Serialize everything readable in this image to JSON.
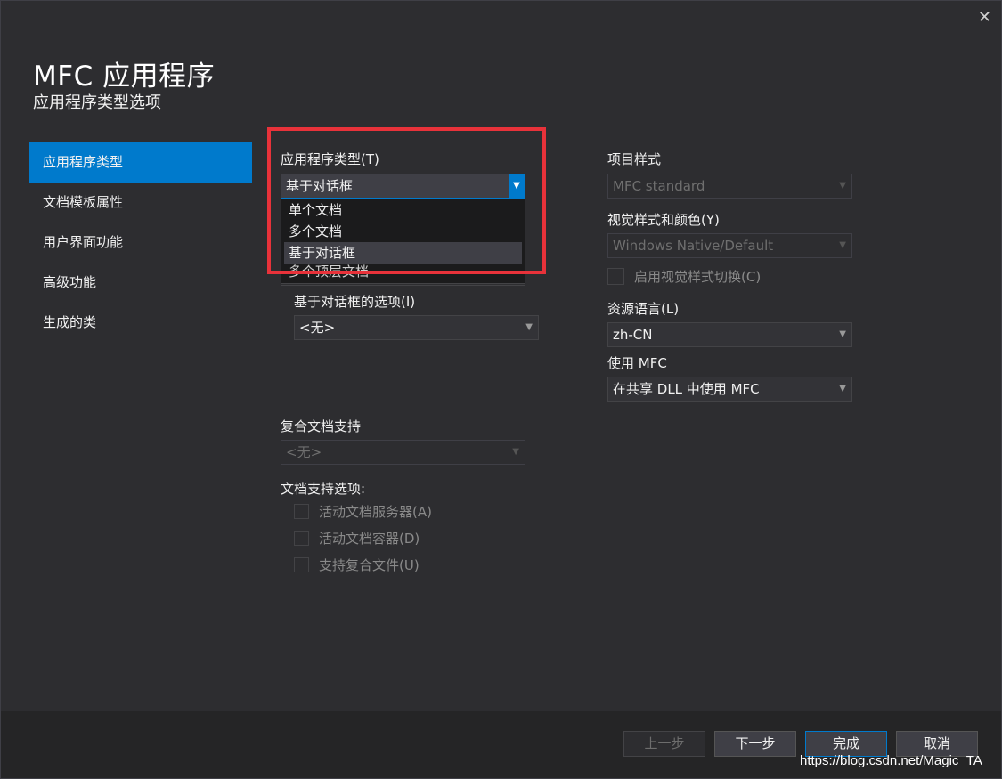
{
  "window": {
    "close_glyph": "✕"
  },
  "header": {
    "title": "MFC 应用程序",
    "subtitle": "应用程序类型选项"
  },
  "sidebar": {
    "items": [
      {
        "label": "应用程序类型",
        "active": true
      },
      {
        "label": "文档模板属性"
      },
      {
        "label": "用户界面功能"
      },
      {
        "label": "高级功能"
      },
      {
        "label": "生成的类"
      }
    ]
  },
  "app_type": {
    "label": "应用程序类型(T)",
    "value": "基于对话框",
    "options": [
      "单个文档",
      "多个文档",
      "基于对话框",
      "多个顶层文档"
    ],
    "selected_index": 2
  },
  "dialog_options": {
    "label": "基于对话框的选项(I)",
    "value": "<无>"
  },
  "compound": {
    "label": "复合文档支持",
    "value": "<无>"
  },
  "doc_support": {
    "label": "文档支持选项:",
    "options": [
      "活动文档服务器(A)",
      "活动文档容器(D)",
      "支持复合文件(U)"
    ]
  },
  "project_style": {
    "label": "项目样式",
    "value": "MFC standard"
  },
  "visual_style": {
    "label": "视觉样式和颜色(Y)",
    "value": "Windows Native/Default",
    "toggle_label": "启用视觉样式切换(C)"
  },
  "resource_lang": {
    "label": "资源语言(L)",
    "value": "zh-CN"
  },
  "use_mfc": {
    "label": "使用 MFC",
    "value": "在共享 DLL 中使用 MFC"
  },
  "buttons": {
    "back": "上一步",
    "next": "下一步",
    "finish": "完成",
    "cancel": "取消"
  },
  "watermark": "https://blog.csdn.net/Magic_TA",
  "colors": {
    "accent": "#007acc",
    "highlight": "#e8323a",
    "background": "#2d2d30"
  }
}
